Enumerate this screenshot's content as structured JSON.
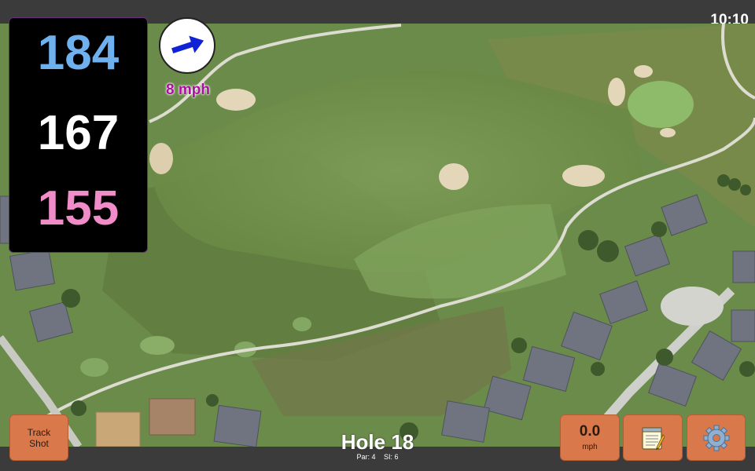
{
  "status_bar": {
    "time": "10:10"
  },
  "distances": {
    "back": "184",
    "middle": "167",
    "front": "155"
  },
  "wind": {
    "speed_text": "8 mph"
  },
  "track_button": {
    "label_line1": "Track",
    "label_line2": "Shot"
  },
  "hole": {
    "title": "Hole 18",
    "par_text": "Par: 4",
    "si_text": "SI: 6"
  },
  "speed_button": {
    "value": "0.0",
    "unit": "mph"
  },
  "icons": {
    "wind": "arrow-icon",
    "notes": "notepad-icon",
    "settings": "gear-icon"
  },
  "colors": {
    "back": "#6fb0ee",
    "middle": "#ffffff",
    "front": "#f08cc8",
    "button": "#d9794b",
    "wind_text": "#a8109e"
  }
}
